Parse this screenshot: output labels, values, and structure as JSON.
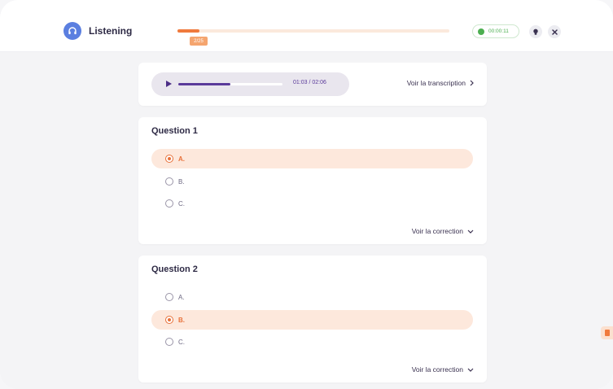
{
  "header": {
    "title": "Listening",
    "progress_label": "2/25",
    "progress_fraction": 0.08,
    "timer": "00:00:11",
    "colors": {
      "accent": "#f07a3d",
      "brand": "#5b7fe0",
      "timer": "#4caf50"
    }
  },
  "audio": {
    "time": "01:03 / 02:06",
    "progress_fraction": 0.5,
    "transcript_label": "Voir la transcription"
  },
  "questions": [
    {
      "title": "Question 1",
      "options": [
        "A.",
        "B.",
        "C."
      ],
      "selected": 0,
      "correction_label": "Voir la correction"
    },
    {
      "title": "Question 2",
      "options": [
        "A.",
        "B.",
        "C."
      ],
      "selected": 1,
      "correction_label": "Voir la correction"
    }
  ],
  "icons": {
    "brand": "headphones-icon",
    "play": "play-icon",
    "timer": "clock-icon",
    "hint": "lightbulb-icon",
    "close": "close-icon",
    "chevron_right": "chevron-right-icon",
    "chevron_down": "chevron-down-icon",
    "side": "report-icon"
  }
}
